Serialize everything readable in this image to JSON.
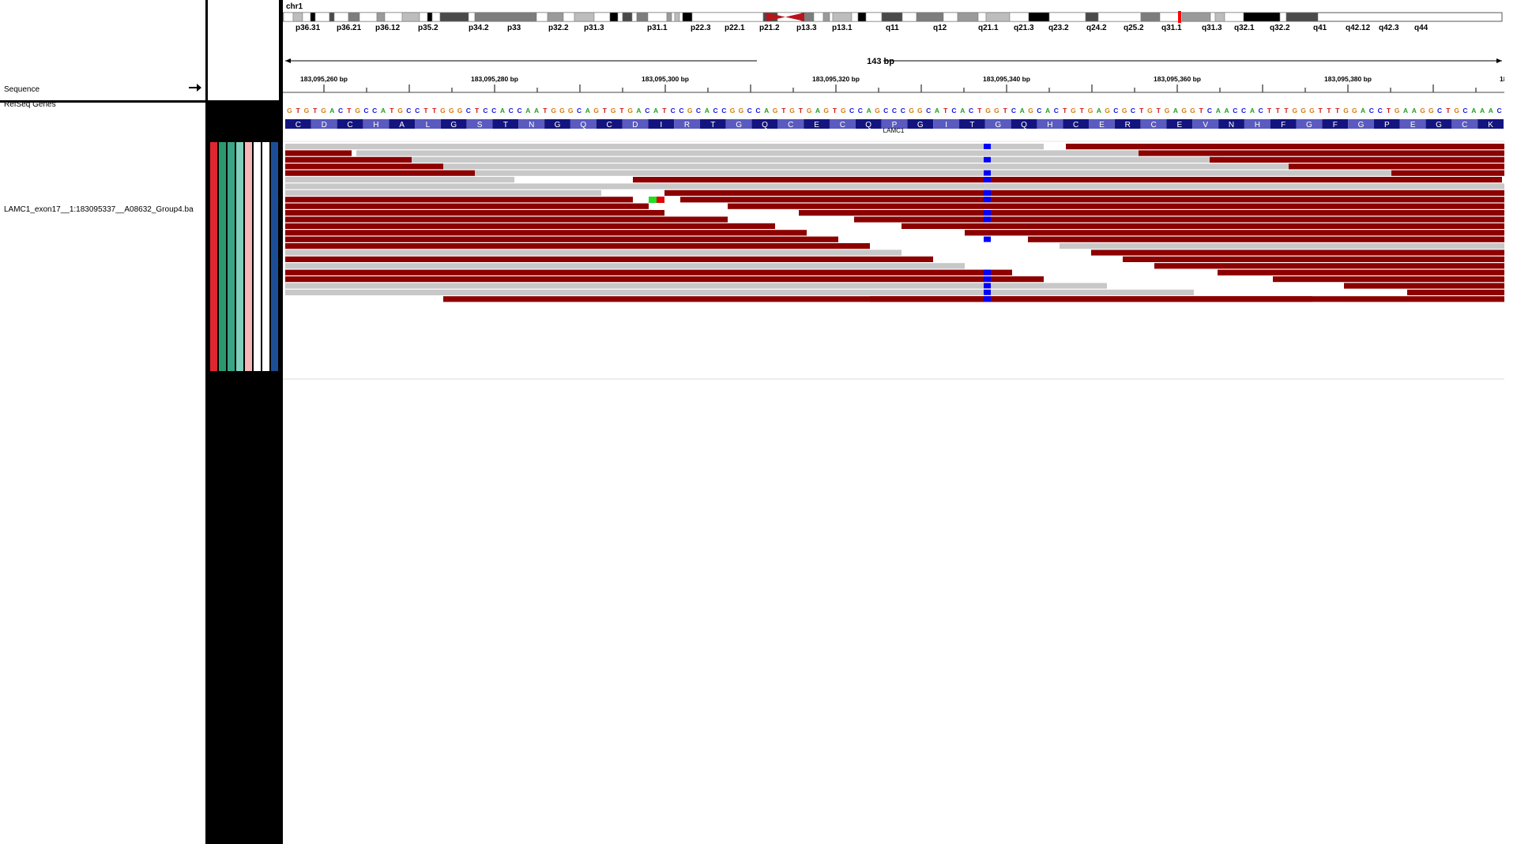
{
  "ideogram": {
    "chromosome": "chr1",
    "bands": [
      "p36.31",
      "p36.21",
      "p36.12",
      "p35.2",
      "p34.2",
      "p33",
      "p32.2",
      "p31.3",
      "p31.1",
      "p22.3",
      "p22.1",
      "p21.2",
      "p13.3",
      "p13.1",
      "q11",
      "q12",
      "q21.1",
      "q21.3",
      "q23.2",
      "q24.2",
      "q25.2",
      "q31.1",
      "q31.3",
      "q32.1",
      "q32.2",
      "q41",
      "q42.12",
      "q42.3",
      "q44"
    ]
  },
  "ruler": {
    "span_label": "143 bp",
    "ticks": [
      "183,095,260 bp",
      "183,095,280 bp",
      "183,095,300 bp",
      "183,095,320 bp",
      "183,095,340 bp",
      "183,095,360 bp",
      "183,095,380 bp",
      "18"
    ]
  },
  "tracks": {
    "sequence_label": "Sequence",
    "genes_label": "RefSeq Genes",
    "bam_label": "LAMC1_exon17__1:183095337__A08632_Group4.ba",
    "strand_arrow": "arrow-right-icon"
  },
  "sequence": "GTGTGACTGCCATGCCTTGGGCTCCACCAATGGGCAGTGTGACATCCGCACCGGCCAGTGTGAGTGCCAGCCCGGCATCACTGGTCAGCACTGTGAGCGCTGTGAGGTCAACCACTTTGGGTTTGGACCTGAAGGCTGCAAAC",
  "amino_acids": [
    "C",
    "D",
    "C",
    "H",
    "A",
    "L",
    "G",
    "S",
    "T",
    "N",
    "G",
    "Q",
    "C",
    "D",
    "I",
    "R",
    "T",
    "G",
    "Q",
    "C",
    "E",
    "C",
    "Q",
    "P",
    "G",
    "I",
    "T",
    "G",
    "Q",
    "H",
    "C",
    "E",
    "R",
    "C",
    "E",
    "V",
    "N",
    "H",
    "F",
    "G",
    "F",
    "G",
    "P",
    "E",
    "G",
    "C",
    "K"
  ],
  "gene_name": "LAMC1",
  "colors": {
    "A": "#22a022",
    "C": "#1515e0",
    "G": "#d47e10",
    "T": "#d11515",
    "read_reverse": "#8c0000",
    "read_forward": "#c8c8c8",
    "mismatch": "#0000ff"
  }
}
